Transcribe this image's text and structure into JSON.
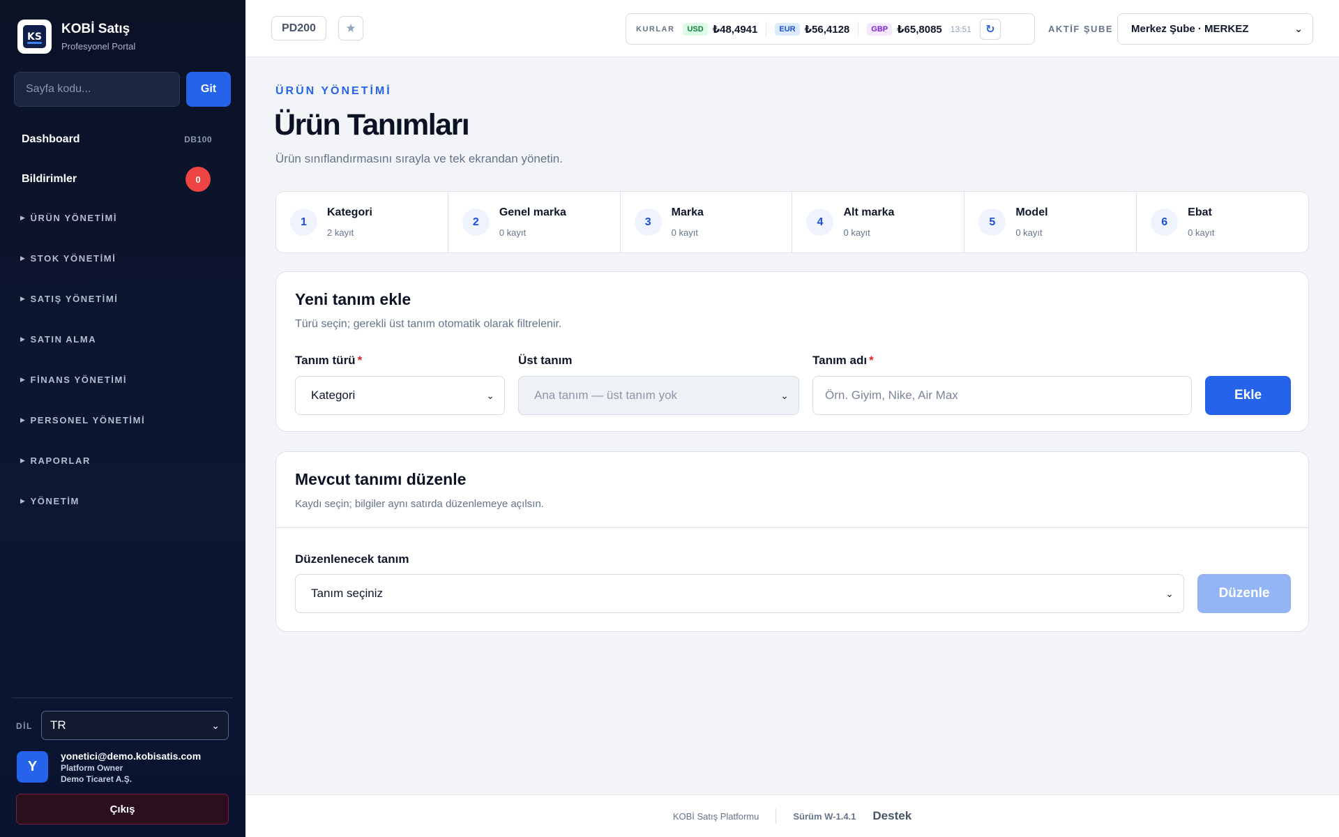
{
  "brand": {
    "name": "KOBİ Satış",
    "subtitle": "Profesyonel Portal",
    "logo_text": "KS"
  },
  "search": {
    "placeholder": "Sayfa kodu...",
    "button": "Git"
  },
  "nav": {
    "dashboard": {
      "label": "Dashboard",
      "code": "DB100"
    },
    "notifications": {
      "label": "Bildirimler",
      "count": "0"
    },
    "sections": [
      "ÜRÜN YÖNETİMİ",
      "STOK YÖNETİMİ",
      "SATIŞ YÖNETİMİ",
      "SATIN ALMA",
      "FİNANS YÖNETİMİ",
      "PERSONEL YÖNETİMİ",
      "RAPORLAR",
      "YÖNETİM"
    ]
  },
  "language": {
    "label": "DİL",
    "value": "TR"
  },
  "user": {
    "initial": "Y",
    "email": "yonetici@demo.kobisatis.com",
    "role": "Platform Owner",
    "company": "Demo Ticaret A.Ş."
  },
  "logout": "Çıkış",
  "topbar": {
    "page_code": "PD200",
    "rates_label": "KURLAR",
    "rates": [
      {
        "code": "USD",
        "value": "₺48,4941",
        "bg": "#dcfce7",
        "fg": "#15803d"
      },
      {
        "code": "EUR",
        "value": "₺56,4128",
        "bg": "#dbeafe",
        "fg": "#1d4ed8"
      },
      {
        "code": "GBP",
        "value": "₺65,8085",
        "bg": "#f3e8ff",
        "fg": "#7e22ce"
      }
    ],
    "rates_time": "13:51",
    "branch_label": "AKTİF ŞUBE",
    "branch_value": "Merkez Şube · MERKEZ"
  },
  "header": {
    "eyebrow": "ÜRÜN YÖNETİMİ",
    "title": "Ürün Tanımları",
    "description": "Ürün sınıflandırmasını sırayla ve tek ekrandan yönetin."
  },
  "steps": [
    {
      "num": "1",
      "title": "Kategori",
      "count": "2 kayıt"
    },
    {
      "num": "2",
      "title": "Genel marka",
      "count": "0 kayıt"
    },
    {
      "num": "3",
      "title": "Marka",
      "count": "0 kayıt"
    },
    {
      "num": "4",
      "title": "Alt marka",
      "count": "0 kayıt"
    },
    {
      "num": "5",
      "title": "Model",
      "count": "0 kayıt"
    },
    {
      "num": "6",
      "title": "Ebat",
      "count": "0 kayıt"
    }
  ],
  "add_card": {
    "title": "Yeni tanım ekle",
    "subtitle": "Türü seçin; gerekli üst tanım otomatik olarak filtrelenir.",
    "type_label": "Tanım türü",
    "type_value": "Kategori",
    "parent_label": "Üst tanım",
    "parent_value": "Ana tanım — üst tanım yok",
    "name_label": "Tanım adı",
    "name_placeholder": "Örn. Giyim, Nike, Air Max",
    "required_mark": "*",
    "submit": "Ekle"
  },
  "edit_card": {
    "title": "Mevcut tanımı düzenle",
    "subtitle": "Kaydı seçin; bilgiler aynı satırda düzenlemeye açılsın.",
    "select_label": "Düzenlenecek tanım",
    "select_value": "Tanım seçiniz",
    "submit": "Düzenle"
  },
  "footer": {
    "platform": "KOBİ Satış Platformu",
    "version": "Sürüm W-1.4.1",
    "support": "Destek"
  },
  "colors": {
    "accent": "#2563eb",
    "sidebar_bg": "#0b1226",
    "danger": "#ef4444"
  },
  "icons": {
    "favorite": "star-icon",
    "refresh": "refresh-icon",
    "dropdown": "chevron-down-icon",
    "section": "caret-right-icon"
  }
}
